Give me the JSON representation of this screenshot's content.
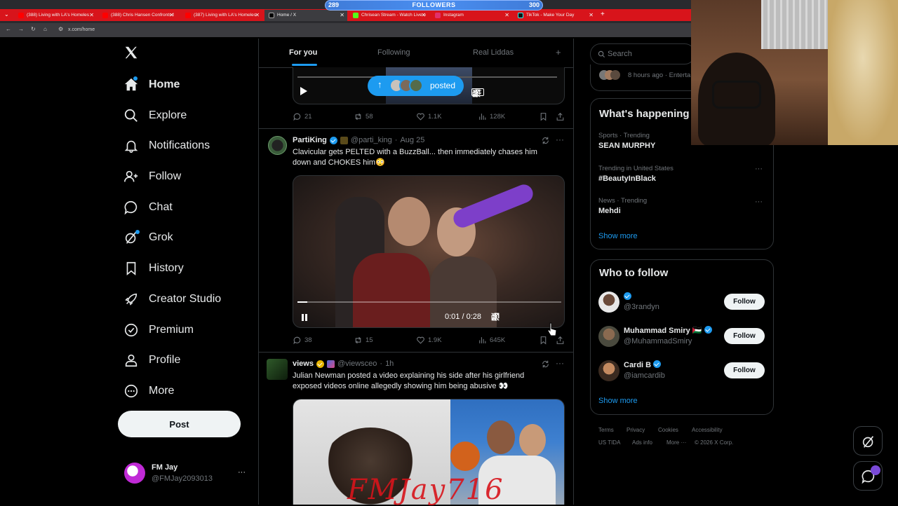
{
  "browser": {
    "tabs": [
      {
        "label": "(388) Living with LA's Homeles",
        "active": false
      },
      {
        "label": "(388) Chris Hansen Confronts I",
        "active": false
      },
      {
        "label": "(387) Living with LA's Homeles",
        "active": false
      },
      {
        "label": "Home / X",
        "active": true
      },
      {
        "label": "Chrisean Stream - Watch Live o",
        "active": false
      },
      {
        "label": "Instagram",
        "active": false
      },
      {
        "label": "TikTok - Make Your Day",
        "active": false
      }
    ],
    "url": "x.com/home",
    "add_tab": "+"
  },
  "overlay": {
    "followers_label": "FOLLOWERS",
    "followers_current": "289",
    "followers_goal": "300"
  },
  "sidebar": {
    "items": [
      {
        "label": "Home",
        "icon": "home-icon"
      },
      {
        "label": "Explore",
        "icon": "search-icon"
      },
      {
        "label": "Notifications",
        "icon": "bell-icon"
      },
      {
        "label": "Follow",
        "icon": "person-add-icon"
      },
      {
        "label": "Chat",
        "icon": "chat-icon"
      },
      {
        "label": "Grok",
        "icon": "grok-icon"
      },
      {
        "label": "History",
        "icon": "bookmark-icon"
      },
      {
        "label": "Creator Studio",
        "icon": "rocket-icon"
      },
      {
        "label": "Premium",
        "icon": "verified-icon"
      },
      {
        "label": "Profile",
        "icon": "person-icon"
      },
      {
        "label": "More",
        "icon": "more-circle-icon"
      }
    ],
    "post_label": "Post",
    "account": {
      "name": "FM Jay",
      "handle": "@FMJay2093013",
      "more": "···"
    }
  },
  "feed": {
    "tabs": [
      "For you",
      "Following",
      "Real Liddas"
    ],
    "add": "+",
    "posted_pill": "posted",
    "post1": {
      "replies": "21",
      "reposts": "58",
      "likes": "1.1K",
      "views": "128K",
      "time_fragment": "5"
    },
    "post2": {
      "name": "PartiKing",
      "handle": "@parti_king",
      "sep": "·",
      "date": "Aug 25",
      "text_line1": "Clavicular gets PELTED with a BuzzBall... then immediately chases him",
      "text_line2": "down and CHOKES him😳",
      "video_time": "0:01 / 0:28",
      "replies": "38",
      "reposts": "15",
      "likes": "1.9K",
      "views": "645K",
      "video_progress": 0.036
    },
    "post3": {
      "name": "views",
      "handle": "@viewsceo",
      "sep": "·",
      "date": "1h",
      "text_line1": "Julian Newman posted a video explaining his side after his girlfriend",
      "text_line2": "exposed videos online allegedly showing him being abusive 👀",
      "watermark": "FMJay716"
    }
  },
  "right": {
    "search_placeholder": "Search",
    "top_meta": "8 hours ago · Enterta",
    "happening_title": "What's happening",
    "trends": [
      {
        "meta": "Sports · Trending",
        "title": "SEAN MURPHY"
      },
      {
        "meta": "Trending in United States",
        "title": "#BeautyInBlack"
      },
      {
        "meta": "News · Trending",
        "title": "Mehdi"
      }
    ],
    "show_more": "Show more",
    "who_title": "Who to follow",
    "suggestions": [
      {
        "name": "",
        "handle": "@3randyn"
      },
      {
        "name": "Muhammad Smiry 🇵🇸",
        "handle": "@MuhammadSmiry"
      },
      {
        "name": "Cardi B",
        "handle": "@iamcardib"
      }
    ],
    "follow_label": "Follow",
    "footer_row1": [
      "Terms",
      "Privacy",
      "Cookies",
      "Accessibility"
    ],
    "footer_row2": [
      "US TIDA",
      "Ads info",
      "More ···",
      "© 2026 X Corp."
    ]
  },
  "colors": {
    "accent": "#1d9bf0",
    "tabbar_red": "#d8141b",
    "background": "#000000"
  }
}
